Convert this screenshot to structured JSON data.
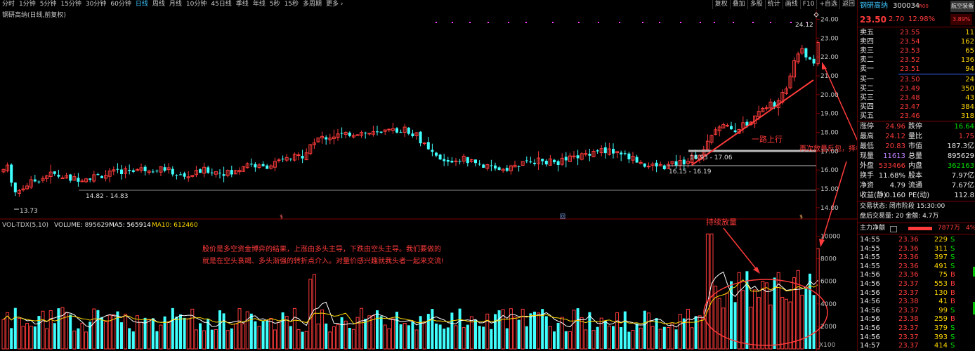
{
  "toolbar": {
    "items": [
      "分时",
      "1分钟",
      "5分钟",
      "15分钟",
      "30分钟",
      "60分钟",
      "日线",
      "周线",
      "月线",
      "10分钟",
      "45日线",
      "季线",
      "年线",
      "5秒",
      "15秒",
      "多周期",
      "更多 ›"
    ],
    "active_index": 6,
    "right_items": [
      "复权",
      "叠加",
      "多股",
      "统计",
      "画线",
      "F10",
      "+自选",
      "返回"
    ]
  },
  "chart": {
    "title": "钢研高纳(日线,前复权)",
    "price_axis": [
      "24.00",
      "23.00",
      "22.00",
      "21.00",
      "20.00",
      "19.00",
      "18.00",
      "17.00",
      "16.00",
      "15.00",
      "14.00"
    ],
    "price_range": [
      13.4,
      24.5
    ],
    "vol_axis": [
      "10000",
      "8000",
      "6000",
      "4000",
      "2000"
    ],
    "vol_unit": "X100",
    "vol_max": 10400,
    "labels": {
      "high": "24.12",
      "low": "13.73",
      "range1": "14.82 - 14.83",
      "range2": "16.15 - 16.19",
      "range3": "16.93 - 17.06"
    },
    "annotations": {
      "trend": "一路上行",
      "volume_again": "再次放量反包，择机点进",
      "continuous": "持续放量",
      "note_line1": "股价是多空资金博弈的结果，上涨由多头主导，下跌由空头主导。我们要做的",
      "note_line2": "就是在空头衰竭、多头渐强的转折点介入。对量价感兴趣就我头者一起来交流!"
    },
    "vol_legend": {
      "name": "VOL-TDX(5,10)",
      "volume": "VOLUME: 895629",
      "ma5": "MA5: 565914",
      "ma10": "MA10: 612460"
    },
    "markers": [
      "$",
      "回",
      "$"
    ],
    "colors": {
      "up": "#ff3b3b",
      "down": "#40ffff",
      "ma5": "#ffffff",
      "ma10": "#ffd800"
    }
  },
  "panel": {
    "name": "钢研高纳",
    "code": "300034",
    "badge": "R00",
    "right_title": "航空装备",
    "price": "23.50",
    "change": "2.70",
    "pct": "12.98%",
    "right_pct": "3.89%",
    "asks": [
      {
        "label": "卖五",
        "price": "23.55",
        "vol": "11"
      },
      {
        "label": "卖四",
        "price": "23.54",
        "vol": "162"
      },
      {
        "label": "卖三",
        "price": "23.53",
        "vol": "65"
      },
      {
        "label": "卖二",
        "price": "23.52",
        "vol": "136"
      },
      {
        "label": "卖一",
        "price": "23.51",
        "vol": "94"
      }
    ],
    "bids": [
      {
        "label": "买一",
        "price": "23.50",
        "vol": "24"
      },
      {
        "label": "买二",
        "price": "23.49",
        "vol": "350"
      },
      {
        "label": "买三",
        "price": "23.48",
        "vol": "43"
      },
      {
        "label": "买四",
        "price": "23.47",
        "vol": "384"
      },
      {
        "label": "买五",
        "price": "23.46",
        "vol": "318"
      }
    ],
    "stats": [
      {
        "l1": "涨停",
        "v1": "24.96",
        "l2": "跌停",
        "v2": "16.64",
        "c1": "red",
        "c2": "green"
      },
      {
        "l1": "最高",
        "v1": "24.12",
        "l2": "量比",
        "v2": "1.75",
        "c1": "red",
        "c2": "red"
      },
      {
        "l1": "最低",
        "v1": "20.83",
        "l2": "市值",
        "v2": "187.3亿",
        "c1": "red",
        "c2": "white"
      },
      {
        "l1": "现量",
        "v1": "11613",
        "l2": "总量",
        "v2": "895629",
        "c1": "purple",
        "c2": "white"
      },
      {
        "l1": "外盘",
        "v1": "533466",
        "l2": "内盘",
        "v2": "362163",
        "c1": "red",
        "c2": "green"
      },
      {
        "l1": "换手",
        "v1": "11.68%",
        "l2": "股本",
        "v2": "7.97亿",
        "c1": "white",
        "c2": "white"
      },
      {
        "l1": "净资",
        "v1": "4.79",
        "l2": "流通",
        "v2": "7.67亿",
        "c1": "white",
        "c2": "white"
      },
      {
        "l1": "收益(静)",
        "v1": "0.160",
        "l2": "PE(动)",
        "v2": "112.8",
        "c1": "white",
        "c2": "white"
      }
    ],
    "status": "交易状态: 闭市阶段 15:30:00",
    "after_hours": "盘后交易量: 20  金额: 4.7万",
    "flow_label": "主力净额",
    "flow_value": "7877万",
    "flow_pct": "4%",
    "ticks": [
      {
        "t": "14:55",
        "p": "23.36",
        "v": "229",
        "s": "S"
      },
      {
        "t": "14:55",
        "p": "23.36",
        "v": "311",
        "s": "S"
      },
      {
        "t": "14:55",
        "p": "23.36",
        "v": "397",
        "s": "S"
      },
      {
        "t": "14:55",
        "p": "23.36",
        "v": "491",
        "s": "S"
      },
      {
        "t": "14:56",
        "p": "23.36",
        "v": "75",
        "s": "B"
      },
      {
        "t": "14:56",
        "p": "23.37",
        "v": "553",
        "s": "B"
      },
      {
        "t": "14:56",
        "p": "23.37",
        "v": "130",
        "s": "B"
      },
      {
        "t": "14:56",
        "p": "23.38",
        "v": "41",
        "s": "B"
      },
      {
        "t": "14:56",
        "p": "23.37",
        "v": "99",
        "s": "S"
      },
      {
        "t": "14:56",
        "p": "23.38",
        "v": "259",
        "s": "B"
      },
      {
        "t": "14:56",
        "p": "23.37",
        "v": "379",
        "s": "S"
      },
      {
        "t": "14:56",
        "p": "23.37",
        "v": "393",
        "s": "S"
      },
      {
        "t": "14:57",
        "p": "23.37",
        "v": "414",
        "s": "S"
      }
    ]
  }
}
